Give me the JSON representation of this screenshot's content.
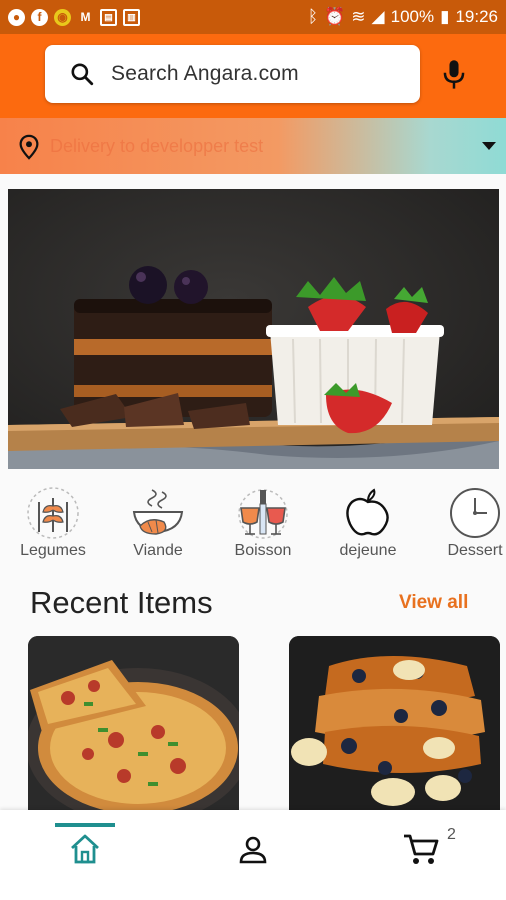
{
  "status_bar": {
    "battery_percent": "100%",
    "time": "19:26",
    "icons": [
      "notification-icon",
      "facebook-icon",
      "app-notification-icon",
      "gmail-icon",
      "sim-icon",
      "clipboard-icon",
      "bluetooth-icon",
      "alarm-icon",
      "wifi-icon",
      "signal-icon",
      "battery-icon"
    ]
  },
  "header": {
    "search_placeholder": "Search Angara.com",
    "mic_icon": "microphone-icon",
    "background_color": "#fc6a0f"
  },
  "delivery": {
    "text": "Delivery to developper test",
    "icon": "location-pin-icon"
  },
  "categories": [
    {
      "label": "Legumes",
      "icon": "wheat-icon"
    },
    {
      "label": "Viande",
      "icon": "food-bowl-icon"
    },
    {
      "label": "Boisson",
      "icon": "drinks-icon"
    },
    {
      "label": "dejeune",
      "icon": "apple-icon"
    },
    {
      "label": "Dessert",
      "icon": "clock-icon"
    }
  ],
  "recent": {
    "title": "Recent Items",
    "view_all": "View all",
    "accent_color": "#e8711f"
  },
  "bottom_nav": {
    "items": [
      "home-icon",
      "profile-icon",
      "cart-icon"
    ],
    "cart_count": "2",
    "active_color": "#1f8f8f"
  }
}
